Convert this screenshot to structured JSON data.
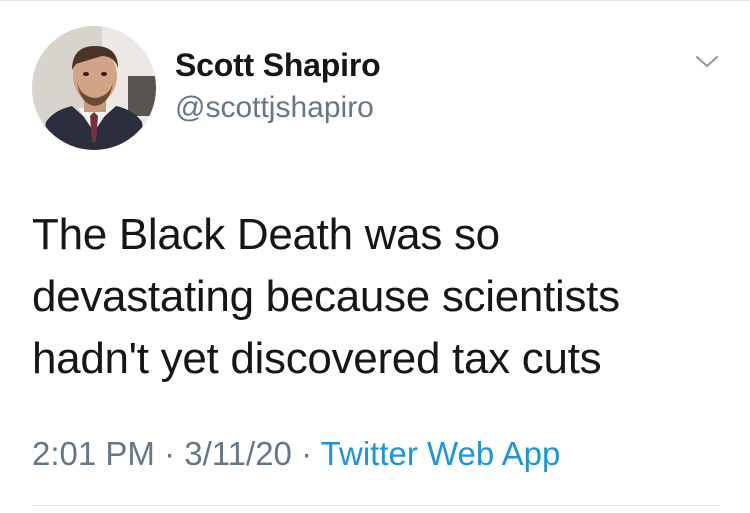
{
  "tweet": {
    "author": {
      "display_name": "Scott Shapiro",
      "handle": "@scottjshapiro"
    },
    "text_lines": [
      "The Black Death was so",
      "devastating because scientists",
      "hadn't yet discovered tax cuts"
    ],
    "time": "2:01 PM",
    "separator": "·",
    "date": "3/11/20",
    "source": "Twitter Web App"
  },
  "icons": {
    "more_menu": "chevron-down-icon"
  },
  "colors": {
    "text_primary": "#14171a",
    "text_secondary": "#657786",
    "link": "#1b95e0",
    "divider": "#e1e8ed"
  }
}
